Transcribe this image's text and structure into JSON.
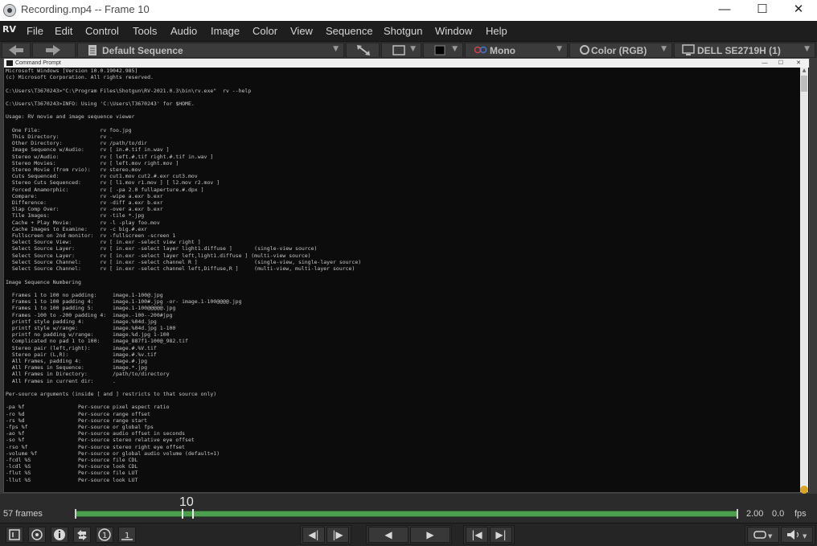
{
  "window": {
    "title": "Recording.mp4 -- Frame 10",
    "minimize": "—",
    "maximize": "☐",
    "close": "✕"
  },
  "menu": {
    "logo": "RV",
    "items": [
      "File",
      "Edit",
      "Control",
      "Tools",
      "Audio",
      "Image",
      "Color",
      "View",
      "Sequence",
      "Shotgun",
      "Window",
      "Help"
    ]
  },
  "toolbar": {
    "back_icon": "arrow-left-icon",
    "forward_icon": "arrow-right-icon",
    "sequence": "Default Sequence",
    "mono": "Mono",
    "color": "Color (RGB)",
    "display": "DELL SE2719H (1)"
  },
  "console": {
    "window_title": "Command Prompt",
    "text": "Microsoft Windows [Version 10.0.19042.985]\n(c) Microsoft Corporation. All rights reserved.\n\nC:\\Users\\T3670243>\"C:\\Program Files\\Shotgun\\RV-2021.0.3\\bin\\rv.exe\"  rv --help\n\nC:\\Users\\T3670243>INFO: Using 'C:\\Users\\T3670243' for $HOME.\n\nUsage: RV movie and image sequence viewer\n\n  One File:                   rv foo.jpg\n  This Directory:             rv .\n  Other Directory:            rv /path/to/dir\n  Image Sequence w/Audio:     rv [ in.#.tif in.wav ]\n  Stereo w/Audio:             rv [ left.#.tif right.#.tif in.wav ]\n  Stereo Movies:              rv [ left.mov right.mov ]\n  Stereo Movie (from rvio):   rv stereo.mov\n  Cuts Sequenced:             rv cut1.mov cut2.#.exr cut3.mov\n  Stereo Cuts Sequenced:      rv [ l1.mov r1.mov ] [ l2.mov r2.mov ]\n  Forced Anamorphic:          rv [ -pa 2.0 fullaperture.#.dpx ]\n  Compare:                    rv -wipe a.exr b.exr\n  Difference:                 rv -diff a.exr b.exr\n  Slap Comp Over:             rv -over a.exr b.exr\n  Tile Images:                rv -tile *.jpg\n  Cache + Play Movie:         rv -l -play foo.mov\n  Cache Images to Examine:    rv -c big.#.exr\n  Fullscreen on 2nd monitor:  rv -fullscreen -screen 1\n  Select Source View:         rv [ in.exr -select view right ]\n  Select Source Layer:        rv [ in.exr -select layer light1.diffuse ]       (single-view source)\n  Select Source Layer:        rv [ in.exr -select layer left,light1.diffuse ] (multi-view source)\n  Select Source Channel:      rv [ in.exr -select channel R ]                  (single-view, single-layer source)\n  Select Source Channel:      rv [ in.exr -select channel left,Diffuse,R ]     (multi-view, multi-layer source)\n\nImage Sequence Numbering\n\n  Frames 1 to 100 no padding:     image.1-100@.jpg\n  Frames 1 to 100 padding 4:      image.1-100#.jpg -or- image.1-100@@@@.jpg\n  Frames 1 to 100 padding 5:      image.1-100@@@@@.jpg\n  Frames -100 to -200 padding 4:  image.-100--200#jpg\n  printf style padding 4:         image.%04d.jpg\n  printf style w/range:           image.%04d.jpg 1-100\n  printf no padding w/range:      image.%d.jpg 1-100\n  Complicated no pad 1 to 100:    image_887f1-100@_982.tif\n  Stereo pair (left,right):       image.#.%V.tif\n  Stereo pair (L,R):              image.#.%v.tif\n  All Frames, padding 4:          image.#.jpg\n  All Frames in Sequence:         image.*.jpg\n  All Frames in Directory:        /path/to/directory\n  All Frames in current dir:      .\n\nPer-source arguments (inside [ and ] restricts to that source only)\n\n-pa %f                 Per-source pixel aspect ratio\n-ro %d                 Per-source range offset\n-rs %d                 Per-source range start\n-fps %f                Per-source or global fps\n-ao %f                 Per-source audio offset in seconds\n-so %f                 Per-source stereo relative eye offset\n-rso %f                Per-source stereo right eye offset\n-volume %f             Per-source or global audio volume (default=1)\n-fcdl %S               Per-source file CDL\n-lcdl %S               Per-source look CDL\n-flut %S               Per-source file LUT\n-llut %S               Per-source look LUT"
  },
  "timeline": {
    "frames_label": "57 frames",
    "current_frame": "10",
    "current_frame_fraction": 0.16,
    "speed": "2.00",
    "offset": "0.0",
    "fps_label": "fps",
    "track_color": "#4e9e50"
  },
  "bottom": {
    "icons": [
      "annotate-icon",
      "network-icon",
      "info-icon",
      "swap-icon",
      "step-back-one-icon",
      "step-one-icon"
    ],
    "step_back": "◀|",
    "step_fwd": "|▶",
    "play_back": "◀",
    "play_fwd": "▶",
    "to_start": "|◀",
    "to_end": "▶|",
    "loop_icon": "loop-icon",
    "volume_icon": "volume-icon"
  }
}
